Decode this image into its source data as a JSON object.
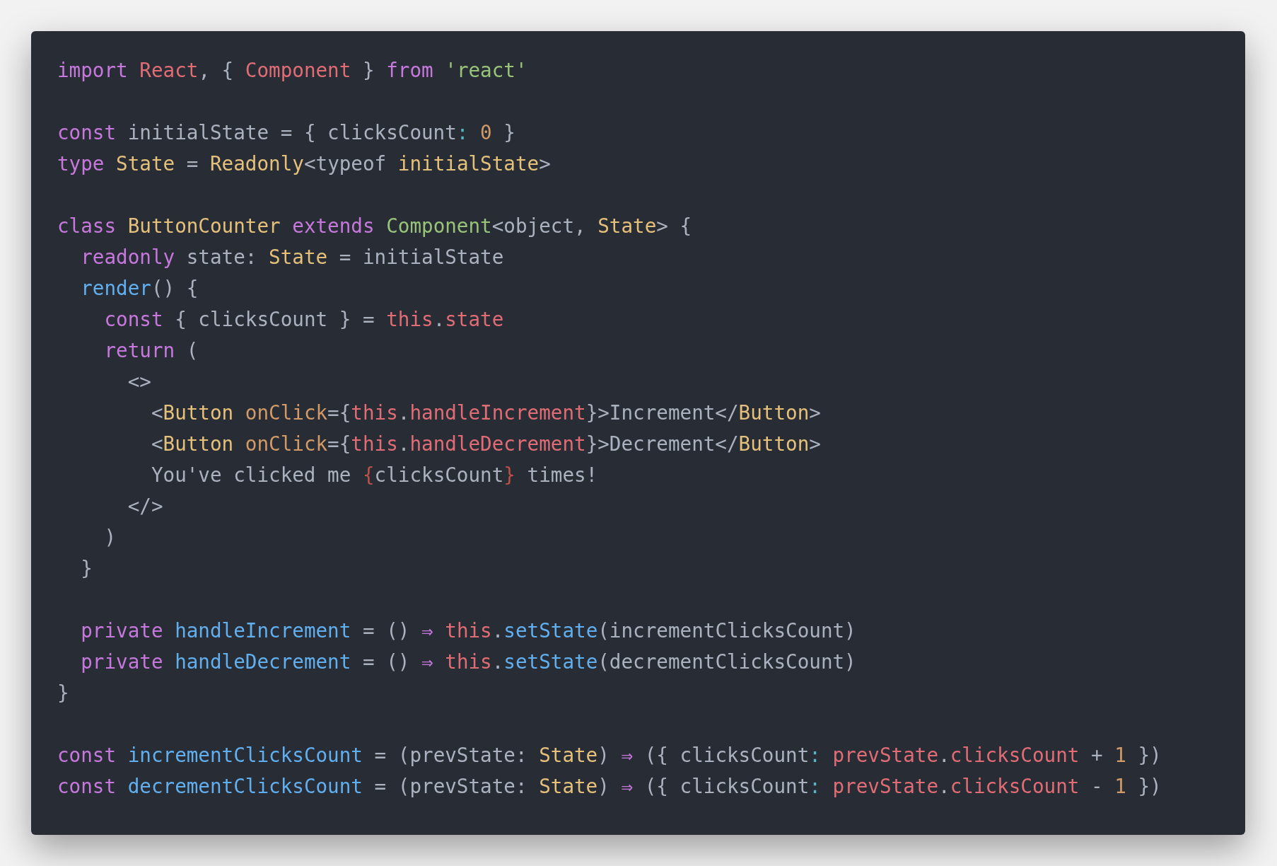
{
  "code_lines": [
    {
      "kind": "code",
      "tokens": [
        {
          "kind": "kw",
          "text": "import "
        },
        {
          "kind": "var",
          "text": "React"
        },
        {
          "kind": "plain",
          "text": ", { "
        },
        {
          "kind": "var",
          "text": "Component"
        },
        {
          "kind": "plain",
          "text": " } "
        },
        {
          "kind": "kw",
          "text": "from "
        },
        {
          "kind": "str",
          "text": "'react'"
        }
      ]
    },
    {
      "kind": "blank"
    },
    {
      "kind": "code",
      "tokens": [
        {
          "kind": "kw",
          "text": "const "
        },
        {
          "kind": "plain",
          "text": "initialState = { clicksCount"
        },
        {
          "kind": "op",
          "text": ": "
        },
        {
          "kind": "num",
          "text": "0"
        },
        {
          "kind": "plain",
          "text": " }"
        }
      ]
    },
    {
      "kind": "code",
      "tokens": [
        {
          "kind": "kw",
          "text": "type "
        },
        {
          "kind": "type",
          "text": "State"
        },
        {
          "kind": "plain",
          "text": " = "
        },
        {
          "kind": "type",
          "text": "Readonly"
        },
        {
          "kind": "plain",
          "text": "<typeof "
        },
        {
          "kind": "type",
          "text": "initialState"
        },
        {
          "kind": "plain",
          "text": ">"
        }
      ]
    },
    {
      "kind": "blank"
    },
    {
      "kind": "code",
      "tokens": [
        {
          "kind": "kw",
          "text": "class "
        },
        {
          "kind": "type",
          "text": "ButtonCounter "
        },
        {
          "kind": "kw",
          "text": "extends "
        },
        {
          "kind": "str",
          "text": "Component"
        },
        {
          "kind": "plain",
          "text": "<object, "
        },
        {
          "kind": "type",
          "text": "State"
        },
        {
          "kind": "plain",
          "text": "> {"
        }
      ]
    },
    {
      "kind": "code",
      "tokens": [
        {
          "kind": "kw",
          "text": "  readonly "
        },
        {
          "kind": "plain",
          "text": "state: "
        },
        {
          "kind": "type",
          "text": "State"
        },
        {
          "kind": "plain",
          "text": " = initialState"
        }
      ]
    },
    {
      "kind": "code",
      "tokens": [
        {
          "kind": "fn",
          "text": "  render"
        },
        {
          "kind": "plain",
          "text": "() {"
        }
      ]
    },
    {
      "kind": "code",
      "tokens": [
        {
          "kind": "kw",
          "text": "    const "
        },
        {
          "kind": "plain",
          "text": "{ clicksCount } = "
        },
        {
          "kind": "var",
          "text": "this"
        },
        {
          "kind": "plain",
          "text": "."
        },
        {
          "kind": "var",
          "text": "state"
        }
      ]
    },
    {
      "kind": "code",
      "tokens": [
        {
          "kind": "kw",
          "text": "    return "
        },
        {
          "kind": "plain",
          "text": "("
        }
      ]
    },
    {
      "kind": "code",
      "tokens": [
        {
          "kind": "plain",
          "text": "      <>"
        }
      ]
    },
    {
      "kind": "code",
      "tokens": [
        {
          "kind": "plain",
          "text": "        <"
        },
        {
          "kind": "type",
          "text": "Button "
        },
        {
          "kind": "num",
          "text": "onClick"
        },
        {
          "kind": "plain",
          "text": "={"
        },
        {
          "kind": "var",
          "text": "this"
        },
        {
          "kind": "plain",
          "text": "."
        },
        {
          "kind": "var",
          "text": "handleIncrement"
        },
        {
          "kind": "plain",
          "text": "}>Increment</"
        },
        {
          "kind": "type",
          "text": "Button"
        },
        {
          "kind": "plain",
          "text": ">"
        }
      ]
    },
    {
      "kind": "code",
      "tokens": [
        {
          "kind": "plain",
          "text": "        <"
        },
        {
          "kind": "type",
          "text": "Button "
        },
        {
          "kind": "num",
          "text": "onClick"
        },
        {
          "kind": "plain",
          "text": "={"
        },
        {
          "kind": "var",
          "text": "this"
        },
        {
          "kind": "plain",
          "text": "."
        },
        {
          "kind": "var",
          "text": "handleDecrement"
        },
        {
          "kind": "plain",
          "text": "}>Decrement</"
        },
        {
          "kind": "type",
          "text": "Button"
        },
        {
          "kind": "plain",
          "text": ">"
        }
      ]
    },
    {
      "kind": "code",
      "tokens": [
        {
          "kind": "plain",
          "text": "        You've clicked me "
        },
        {
          "kind": "brace",
          "text": "{"
        },
        {
          "kind": "plain",
          "text": "clicksCount"
        },
        {
          "kind": "brace",
          "text": "}"
        },
        {
          "kind": "plain",
          "text": " times!"
        }
      ]
    },
    {
      "kind": "code",
      "tokens": [
        {
          "kind": "plain",
          "text": "      </>"
        }
      ]
    },
    {
      "kind": "code",
      "tokens": [
        {
          "kind": "plain",
          "text": "    )"
        }
      ]
    },
    {
      "kind": "code",
      "tokens": [
        {
          "kind": "plain",
          "text": "  }"
        }
      ]
    },
    {
      "kind": "blank"
    },
    {
      "kind": "code",
      "tokens": [
        {
          "kind": "kw",
          "text": "  private "
        },
        {
          "kind": "fn",
          "text": "handleIncrement"
        },
        {
          "kind": "plain",
          "text": " = () "
        },
        {
          "kind": "kw",
          "text": "⇒ "
        },
        {
          "kind": "var",
          "text": "this"
        },
        {
          "kind": "plain",
          "text": "."
        },
        {
          "kind": "fn",
          "text": "setState"
        },
        {
          "kind": "plain",
          "text": "(incrementClicksCount)"
        }
      ]
    },
    {
      "kind": "code",
      "tokens": [
        {
          "kind": "kw",
          "text": "  private "
        },
        {
          "kind": "fn",
          "text": "handleDecrement"
        },
        {
          "kind": "plain",
          "text": " = () "
        },
        {
          "kind": "kw",
          "text": "⇒ "
        },
        {
          "kind": "var",
          "text": "this"
        },
        {
          "kind": "plain",
          "text": "."
        },
        {
          "kind": "fn",
          "text": "setState"
        },
        {
          "kind": "plain",
          "text": "(decrementClicksCount)"
        }
      ]
    },
    {
      "kind": "code",
      "tokens": [
        {
          "kind": "plain",
          "text": "}"
        }
      ]
    },
    {
      "kind": "blank"
    },
    {
      "kind": "code",
      "tokens": [
        {
          "kind": "kw",
          "text": "const "
        },
        {
          "kind": "fn",
          "text": "incrementClicksCount"
        },
        {
          "kind": "plain",
          "text": " = (prevState: "
        },
        {
          "kind": "type",
          "text": "State"
        },
        {
          "kind": "plain",
          "text": ") "
        },
        {
          "kind": "kw",
          "text": "⇒"
        },
        {
          "kind": "plain",
          "text": " ({ clicksCount"
        },
        {
          "kind": "op",
          "text": ": "
        },
        {
          "kind": "var",
          "text": "prevState"
        },
        {
          "kind": "plain",
          "text": "."
        },
        {
          "kind": "var",
          "text": "clicksCount"
        },
        {
          "kind": "plain",
          "text": " + "
        },
        {
          "kind": "num",
          "text": "1"
        },
        {
          "kind": "plain",
          "text": " })"
        }
      ]
    },
    {
      "kind": "code",
      "tokens": [
        {
          "kind": "kw",
          "text": "const "
        },
        {
          "kind": "fn",
          "text": "decrementClicksCount"
        },
        {
          "kind": "plain",
          "text": " = (prevState: "
        },
        {
          "kind": "type",
          "text": "State"
        },
        {
          "kind": "plain",
          "text": ") "
        },
        {
          "kind": "kw",
          "text": "⇒"
        },
        {
          "kind": "plain",
          "text": " ({ clicksCount"
        },
        {
          "kind": "op",
          "text": ": "
        },
        {
          "kind": "var",
          "text": "prevState"
        },
        {
          "kind": "plain",
          "text": "."
        },
        {
          "kind": "var",
          "text": "clicksCount"
        },
        {
          "kind": "plain",
          "text": " - "
        },
        {
          "kind": "num",
          "text": "1"
        },
        {
          "kind": "plain",
          "text": " })"
        }
      ]
    }
  ]
}
